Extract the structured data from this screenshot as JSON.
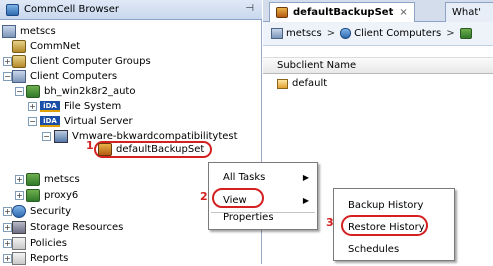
{
  "left_panel": {
    "title": "CommCell Browser",
    "pin_glyph": "⊣",
    "tree": [
      {
        "label": "metscs",
        "icon": "server-icon"
      },
      {
        "label": "CommNet",
        "icon": "commnet-icon"
      },
      {
        "label": "Client Computer Groups",
        "icon": "client-group-icon"
      },
      {
        "label": "Client Computers",
        "icon": "client-computers-icon"
      },
      {
        "label": "bh_win2k8r2_auto",
        "icon": "client-computer-icon"
      },
      {
        "label": "File System",
        "icon": "ida-icon",
        "icon_text": "iDA"
      },
      {
        "label": "Virtual Server",
        "icon": "ida-icon",
        "icon_text": "iDA"
      },
      {
        "label": "Vmware-bkwardcompatibilitytest",
        "icon": "vm-instance-icon"
      },
      {
        "label": "defaultBackupSet",
        "icon": "backupset-icon"
      },
      {
        "label": "metscs",
        "icon": "client-computer-icon"
      },
      {
        "label": "proxy6",
        "icon": "client-computer-icon"
      },
      {
        "label": "Security",
        "icon": "security-icon"
      },
      {
        "label": "Storage Resources",
        "icon": "storage-icon"
      },
      {
        "label": "Policies",
        "icon": "policies-icon"
      },
      {
        "label": "Reports",
        "icon": "reports-icon"
      }
    ],
    "step1": "1"
  },
  "right_panel": {
    "tabs": [
      {
        "label": "defaultBackupSet",
        "close": "×",
        "active": true
      },
      {
        "label": "What'",
        "active": false
      }
    ],
    "breadcrumb": [
      "metscs",
      "Client Computers",
      ""
    ],
    "breadcrumb_sep": ">",
    "column_header": "Subclient Name",
    "rows": [
      "default"
    ]
  },
  "context_menu": {
    "items": [
      "All Tasks",
      "View",
      "Properties"
    ],
    "step2": "2"
  },
  "view_submenu": {
    "items": [
      "Backup History",
      "Restore History",
      "Schedules"
    ],
    "step3": "3"
  },
  "colors": {
    "highlight": "#d42020",
    "header_bg": "#c9d8ee",
    "border": "#8ea3c6"
  }
}
